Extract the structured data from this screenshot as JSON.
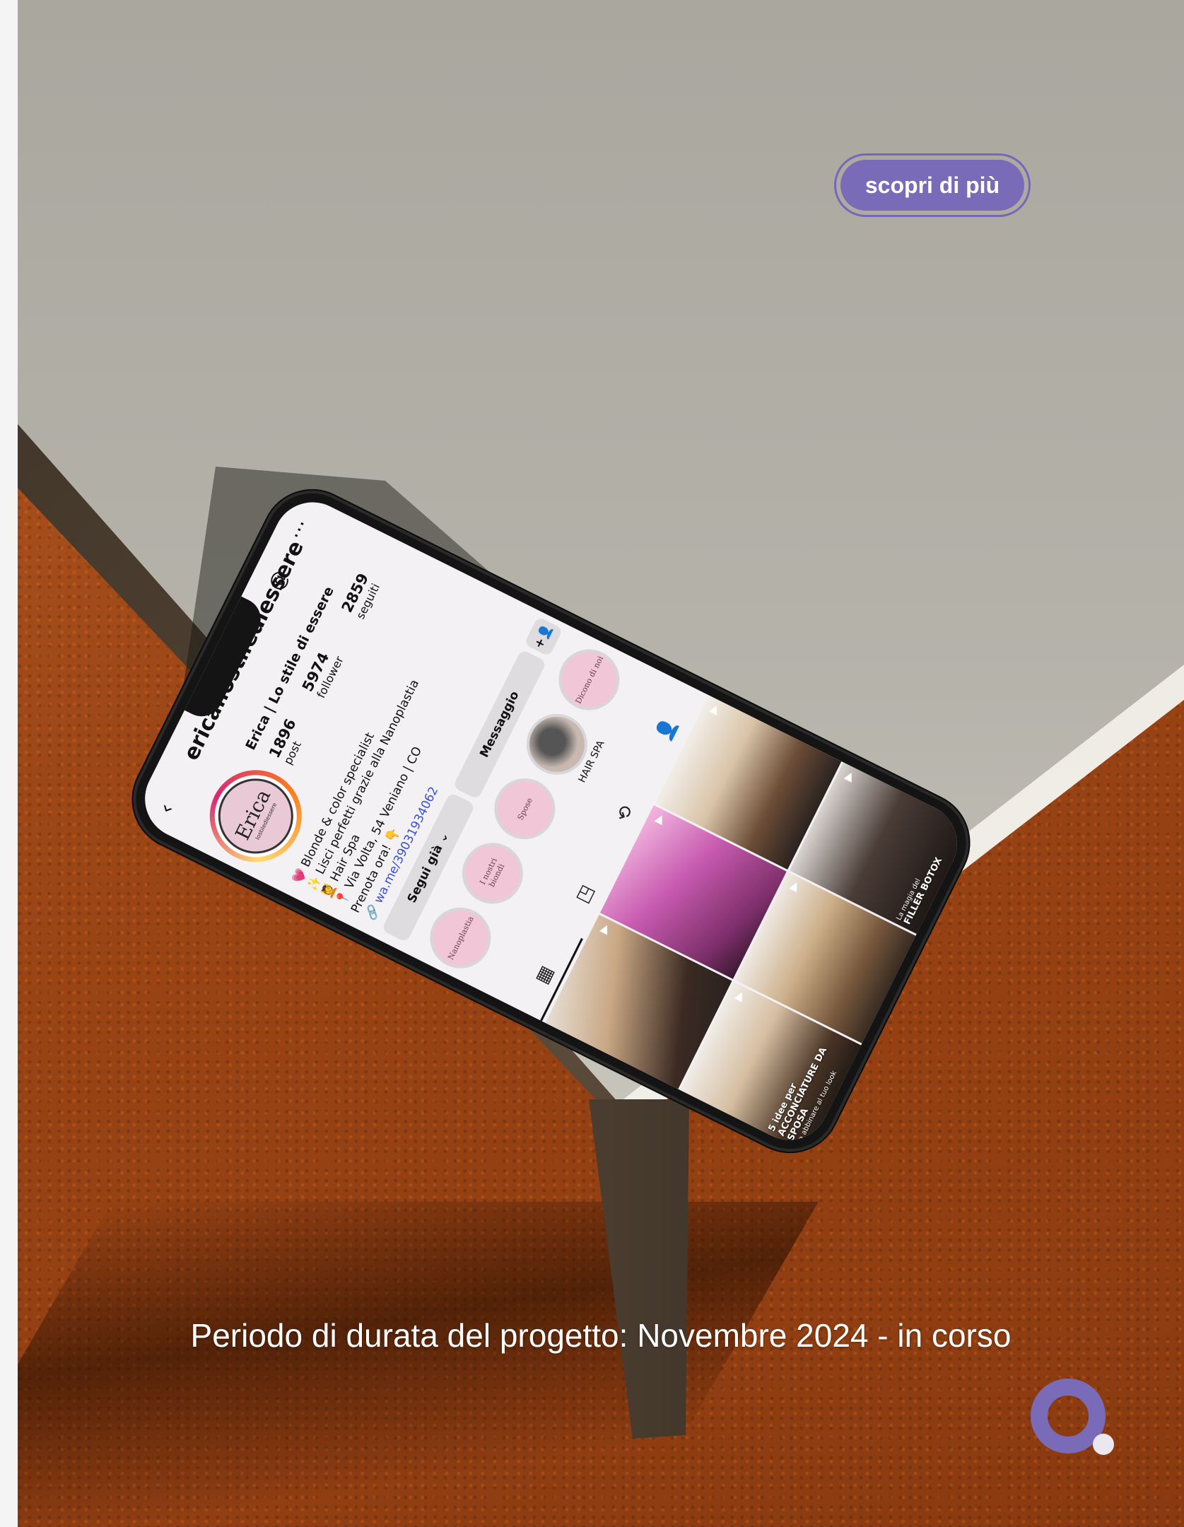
{
  "cta": {
    "label": "scopri di più"
  },
  "caption": "Periodo di durata del progetto: Novembre 2024 - in corso",
  "profile": {
    "username": "erica.lostilediessere",
    "display_name": "Erica | Lo stile di essere",
    "avatar_text": "Erica",
    "avatar_subtext": "lostilediessere",
    "stats": [
      {
        "value": "1896",
        "label": "post"
      },
      {
        "value": "5974",
        "label": "follower"
      },
      {
        "value": "2859",
        "label": "seguiti"
      }
    ],
    "bio": [
      "💗 Blonde & color specialist",
      "✨ Lisci perfetti grazie alla Nanoplastia",
      "💆 Hair Spa",
      "📍 Via Volta, 54 Veniano | CO",
      "Prenota ora! 👇"
    ],
    "link": "wa.me/39031934062"
  },
  "buttons": {
    "follow": "Segui già ⌄",
    "message": "Messaggio",
    "add_person": "+👤"
  },
  "highlights": [
    {
      "label": "",
      "cover": "Nanoplastia"
    },
    {
      "label": "",
      "cover": "I nostri biondi"
    },
    {
      "label": "",
      "cover": "Spose"
    },
    {
      "label": "HAIR SPA",
      "cover": ""
    },
    {
      "label": "",
      "cover": "Dicono di noi"
    }
  ],
  "tabs": [
    "grid-icon",
    "reels-icon",
    "repost-icon",
    "tagged-icon"
  ],
  "grid_posts": [
    {
      "caption": "",
      "sub": ""
    },
    {
      "caption": "",
      "sub": ""
    },
    {
      "caption": "",
      "sub": ""
    },
    {
      "caption": "5 idee per ACCONCIATURE DA SPOSA",
      "sub": "da abbinare al tuo look"
    },
    {
      "caption": "",
      "sub": ""
    },
    {
      "caption": "FILLER BOTOX",
      "sub": "La magia del"
    }
  ],
  "icons": {
    "back": "‹",
    "threads": "@",
    "more": "⋯",
    "reel": "▶",
    "grid": "▦",
    "reels": "◳",
    "repost": "⟲",
    "tagged": "👤"
  }
}
